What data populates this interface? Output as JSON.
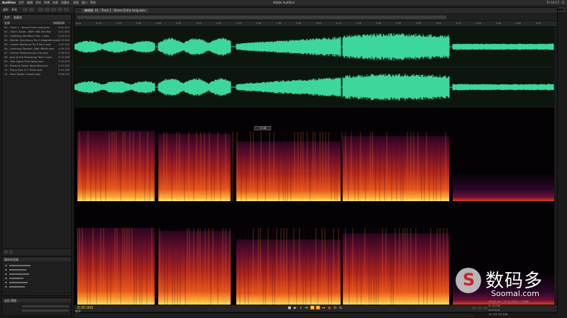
{
  "menubar": {
    "app_name": "Audition",
    "items": [
      "文件",
      "编辑",
      "多轨",
      "剪辑",
      "效果",
      "收藏夹",
      "视图",
      "窗口",
      "帮助"
    ],
    "window_title": "Adobe Audition",
    "right": "Fri 10:17 · Q"
  },
  "toolbar": {
    "mode_labels": [
      "波形",
      "多轨"
    ],
    "workspace": "默认"
  },
  "files_panel": {
    "tabs": [
      "文件",
      "收藏夹"
    ],
    "header_name": "名称",
    "header_duration": "持续时间",
    "files": [
      {
        "name": "01 - Track 1 - Bravo Extra Long.wav",
        "duration": "3:55.322"
      },
      {
        "name": "02 - Glenn Gould - BWV 988 Aria.flac",
        "duration": "4:41.850"
      },
      {
        "name": "03 - Goldberg Variations Var. 1.wav",
        "duration": "2:03.510"
      },
      {
        "name": "04 - Mahler Symphony No.5 Adagietto.wav",
        "duration": "3:20.046"
      },
      {
        "name": "05 - Chopin Nocturne Op.9 No.2.wav",
        "duration": "3:42.102"
      },
      {
        "name": "06 - Listening Session 24bit 96kHz.wav",
        "duration": "4:06.700"
      },
      {
        "name": "07 - Vienna Philharmonic Live.wav",
        "duration": "2:38.914"
      },
      {
        "name": "08 - Jazz at the Pawnshop Take 2.wav",
        "duration": "5:10.288"
      },
      {
        "name": "09 - Test Signal Pink Noise.wav",
        "duration": "1:00.000"
      },
      {
        "name": "10 - Binaural Room Recording.wav",
        "duration": "3:15.430"
      },
      {
        "name": "11 - Piano Solo in F Minor.wav",
        "duration": "2:44.160"
      },
      {
        "name": "12 - Final Master Export.wav",
        "duration": "3:58.020"
      }
    ]
  },
  "media_panel": {
    "title": "媒体浏览器"
  },
  "selection_panel": {
    "title": "选区/视图"
  },
  "editor": {
    "tab_label": "编辑器: 01 - Track 1 - Bravo Extra Long.wav",
    "ruler_ticks": [
      "hms",
      "0:10",
      "0:20",
      "0:30",
      "0:40",
      "0:50",
      "1:00",
      "1:10",
      "1:20",
      "1:30",
      "1:40",
      "1:50",
      "2:00",
      "2:10",
      "2:20",
      "2:30",
      "2:40",
      "2:50",
      "3:00",
      "3:10",
      "3:20",
      "3:30",
      "3:40",
      "3:50"
    ],
    "hud_text": "+0 dB",
    "timecode": "0:00.000",
    "transport": [
      "■",
      "▶",
      "⏸",
      "⏮",
      "⏪",
      "⏩",
      "⏭",
      "●",
      "⟲",
      "⇆"
    ]
  },
  "levels": {
    "label": "电平"
  },
  "status_info": {
    "lines": [
      "48000 Hz • 32 位 (浮点) • 立体声",
      "91.44 MB",
      "4:09.818",
      "147.83 GB 空闲"
    ]
  },
  "watermark": {
    "cn": "数码多",
    "en": "Soomal.com",
    "logo_letter": "S"
  },
  "colors": {
    "waveform": "#3ed79b",
    "waveform_bg": "#0c160f",
    "spectral_hot": "#ffe36a",
    "spectral_mid": "#e0401a",
    "spectral_low": "#5a0f3a"
  },
  "icons": [
    "play-icon",
    "stop-icon",
    "pause-icon",
    "record-icon",
    "loop-icon",
    "zoom-icon",
    "search-icon"
  ]
}
